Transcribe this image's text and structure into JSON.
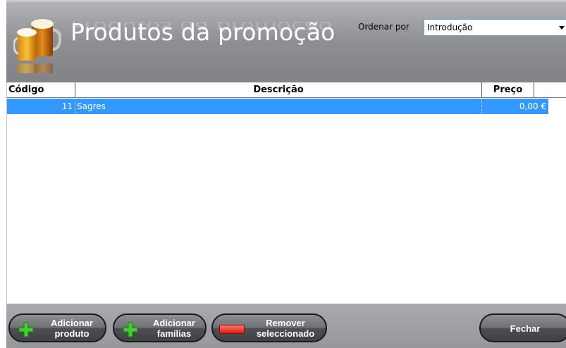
{
  "header": {
    "title": "Produtos da promoção",
    "sort_label": "Ordenar por",
    "sort_value": "Introdução",
    "icon": "beer-mugs-icon"
  },
  "table": {
    "columns": [
      "Código",
      "Descrição",
      "Preço"
    ],
    "rows": [
      {
        "code": "11",
        "description": "Sagres",
        "price": "0,00 €",
        "selected": true
      }
    ]
  },
  "buttons": {
    "add_product": [
      "Adicionar",
      "produto"
    ],
    "add_families": [
      "Adicionar",
      "famílias"
    ],
    "remove_selected": [
      "Remover",
      "seleccionado"
    ],
    "close": "Fechar"
  },
  "colors": {
    "selection": "#3399ff",
    "header_bg": "#8d8f93",
    "plus_icon": "#44cc33",
    "minus_icon": "#e01a10"
  }
}
